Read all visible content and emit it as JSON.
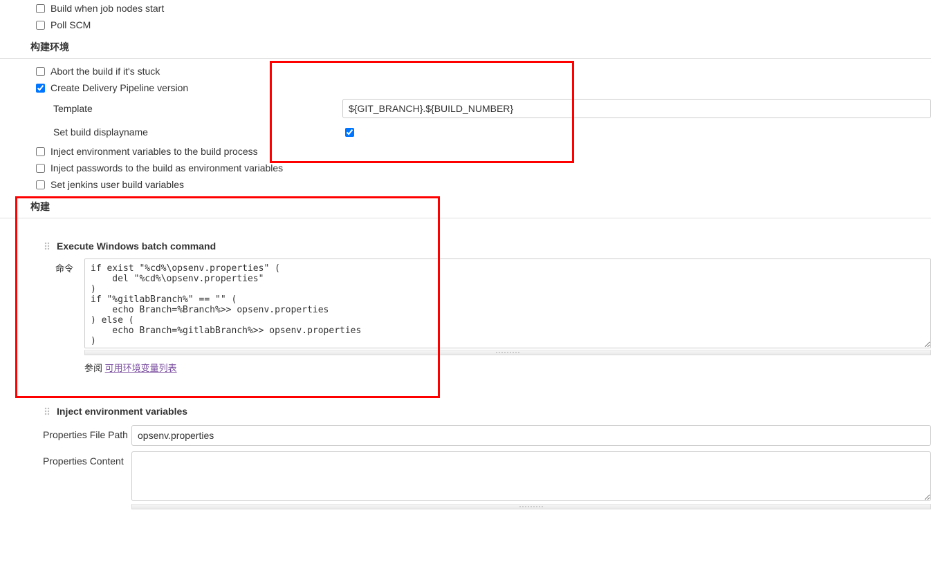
{
  "triggers": {
    "build_when_job_nodes_start_label": "Build when job nodes start",
    "poll_scm_label": "Poll SCM"
  },
  "build_env": {
    "section_title": "构建环境",
    "abort_label": "Abort the build if it's stuck",
    "delivery_label": "Create Delivery Pipeline version",
    "template_label": "Template",
    "template_value": "${GIT_BRANCH}.${BUILD_NUMBER}",
    "set_displayname_label": "Set build displayname",
    "inject_env_label": "Inject environment variables to the build process",
    "inject_passwords_label": "Inject passwords to the build as environment variables",
    "set_jenkins_user_label": "Set jenkins user build variables"
  },
  "build": {
    "section_title": "构建",
    "step1_title": "Execute Windows batch command",
    "command_label": "命令",
    "command_value": "if exist \"%cd%\\opsenv.properties\" (\n    del \"%cd%\\opsenv.properties\"\n)\nif \"%gitlabBranch%\" == \"\" (\n    echo Branch=%Branch%>> opsenv.properties\n) else (\n    echo Branch=%gitlabBranch%>> opsenv.properties\n)",
    "ref_prefix": "参阅 ",
    "ref_link_text": "可用环境变量列表",
    "step2_title": "Inject environment variables",
    "properties_file_path_label": "Properties File Path",
    "properties_file_path_value": "opsenv.properties",
    "properties_content_label": "Properties Content",
    "properties_content_value": ""
  }
}
